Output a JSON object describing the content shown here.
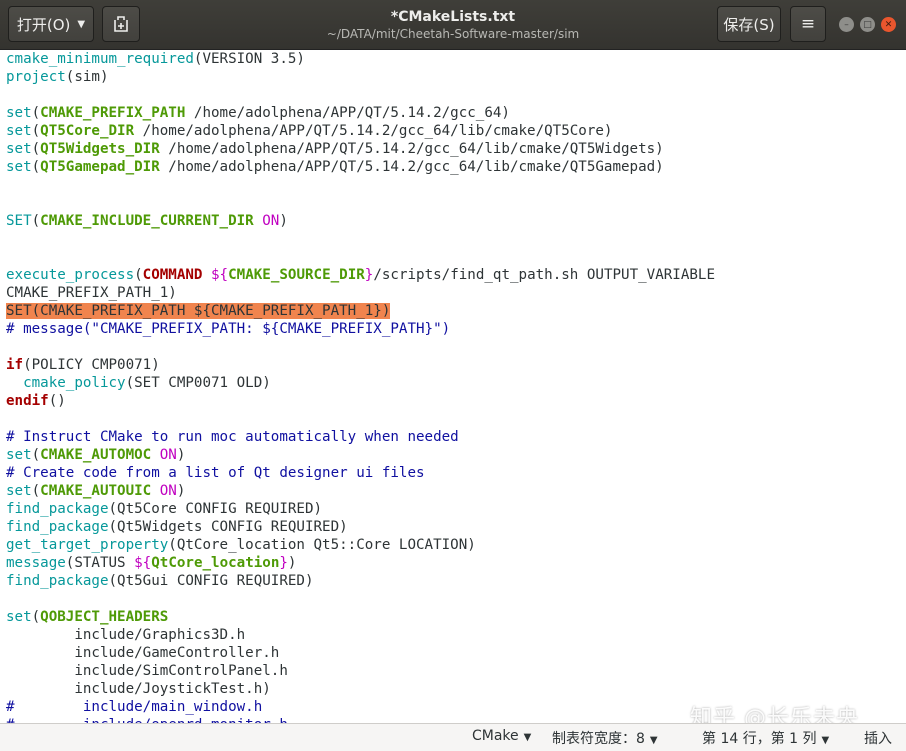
{
  "header": {
    "open_label": "打开(O)",
    "title": "*CMakeLists.txt",
    "subtitle": "~/DATA/mit/Cheetah-Software-master/sim",
    "save_label": "保存(S)",
    "menu_icon": "≡"
  },
  "editor": {
    "lines": [
      [
        [
          "fn",
          "cmake_minimum_required"
        ],
        [
          "p",
          "(VERSION 3.5)"
        ]
      ],
      [
        [
          "fn",
          "project"
        ],
        [
          "p",
          "(sim)"
        ]
      ],
      [],
      [
        [
          "fn",
          "set"
        ],
        [
          "p",
          "("
        ],
        [
          "kv",
          "CMAKE_PREFIX_PATH"
        ],
        [
          "p",
          " /home/adolphena/APP/QT/5.14.2/gcc_64)"
        ]
      ],
      [
        [
          "fn",
          "set"
        ],
        [
          "p",
          "("
        ],
        [
          "kv",
          "QT5Core_DIR"
        ],
        [
          "p",
          " /home/adolphena/APP/QT/5.14.2/gcc_64/lib/cmake/QT5Core)"
        ]
      ],
      [
        [
          "fn",
          "set"
        ],
        [
          "p",
          "("
        ],
        [
          "kv",
          "QT5Widgets_DIR"
        ],
        [
          "p",
          " /home/adolphena/APP/QT/5.14.2/gcc_64/lib/cmake/QT5Widgets)"
        ]
      ],
      [
        [
          "fn",
          "set"
        ],
        [
          "p",
          "("
        ],
        [
          "kv",
          "QT5Gamepad_DIR"
        ],
        [
          "p",
          " /home/adolphena/APP/QT/5.14.2/gcc_64/lib/cmake/QT5Gamepad)"
        ]
      ],
      [],
      [],
      [
        [
          "fn",
          "SET"
        ],
        [
          "p",
          "("
        ],
        [
          "kv",
          "CMAKE_INCLUDE_CURRENT_DIR"
        ],
        [
          "p",
          " "
        ],
        [
          "on",
          "ON"
        ],
        [
          "p",
          ")"
        ]
      ],
      [],
      [],
      [
        [
          "fn",
          "execute_process"
        ],
        [
          "p",
          "("
        ],
        [
          "cmd",
          "COMMAND"
        ],
        [
          "p",
          " "
        ],
        [
          "dol",
          "${"
        ],
        [
          "kv",
          "CMAKE_SOURCE_DIR"
        ],
        [
          "dol",
          "}"
        ],
        [
          "p",
          "/scripts/find_qt_path.sh OUTPUT_VARIABLE"
        ]
      ],
      [
        [
          "p",
          "CMAKE_PREFIX_PATH_1)"
        ]
      ],
      [
        [
          "hl",
          "SET(CMAKE_PREFIX_PATH ${CMAKE_PREFIX_PATH_1})"
        ]
      ],
      [
        [
          "cm",
          "# message(\"CMAKE_PREFIX_PATH: ${CMAKE_PREFIX_PATH}\")"
        ]
      ],
      [],
      [
        [
          "kw",
          "if"
        ],
        [
          "p",
          "(POLICY CMP0071)"
        ]
      ],
      [
        [
          "p",
          "  "
        ],
        [
          "fn",
          "cmake_policy"
        ],
        [
          "p",
          "(SET CMP0071 OLD)"
        ]
      ],
      [
        [
          "kw",
          "endif"
        ],
        [
          "p",
          "()"
        ]
      ],
      [],
      [
        [
          "cm",
          "# Instruct CMake to run moc automatically when needed"
        ]
      ],
      [
        [
          "fn",
          "set"
        ],
        [
          "p",
          "("
        ],
        [
          "kv",
          "CMAKE_AUTOMOC"
        ],
        [
          "p",
          " "
        ],
        [
          "on",
          "ON"
        ],
        [
          "p",
          ")"
        ]
      ],
      [
        [
          "cm",
          "# Create code from a list of Qt designer ui files"
        ]
      ],
      [
        [
          "fn",
          "set"
        ],
        [
          "p",
          "("
        ],
        [
          "kv",
          "CMAKE_AUTOUIC"
        ],
        [
          "p",
          " "
        ],
        [
          "on",
          "ON"
        ],
        [
          "p",
          ")"
        ]
      ],
      [
        [
          "fn",
          "find_package"
        ],
        [
          "p",
          "(Qt5Core CONFIG REQUIRED)"
        ]
      ],
      [
        [
          "fn",
          "find_package"
        ],
        [
          "p",
          "(Qt5Widgets CONFIG REQUIRED)"
        ]
      ],
      [
        [
          "fn",
          "get_target_property"
        ],
        [
          "p",
          "(QtCore_location Qt5::Core LOCATION)"
        ]
      ],
      [
        [
          "fn",
          "message"
        ],
        [
          "p",
          "(STATUS "
        ],
        [
          "dol",
          "${"
        ],
        [
          "kv",
          "QtCore_location"
        ],
        [
          "dol",
          "}"
        ],
        [
          "p",
          ")"
        ]
      ],
      [
        [
          "fn",
          "find_package"
        ],
        [
          "p",
          "(Qt5Gui CONFIG REQUIRED)"
        ]
      ],
      [],
      [
        [
          "fn",
          "set"
        ],
        [
          "p",
          "("
        ],
        [
          "kv",
          "QOBJECT_HEADERS"
        ]
      ],
      [
        [
          "p",
          "        include/Graphics3D.h"
        ]
      ],
      [
        [
          "p",
          "        include/GameController.h"
        ]
      ],
      [
        [
          "p",
          "        include/SimControlPanel.h"
        ]
      ],
      [
        [
          "p",
          "        include/JoystickTest.h)"
        ]
      ],
      [
        [
          "cm",
          "#        include/main_window.h"
        ]
      ],
      [
        [
          "cm",
          "#        include/openrd_monitor.h"
        ]
      ]
    ]
  },
  "watermark": "知乎 @长乐未央",
  "status": {
    "language": "CMake",
    "tab_width": "制表符宽度：8",
    "position": "第 14 行，第 1 列",
    "mode": "插入"
  }
}
